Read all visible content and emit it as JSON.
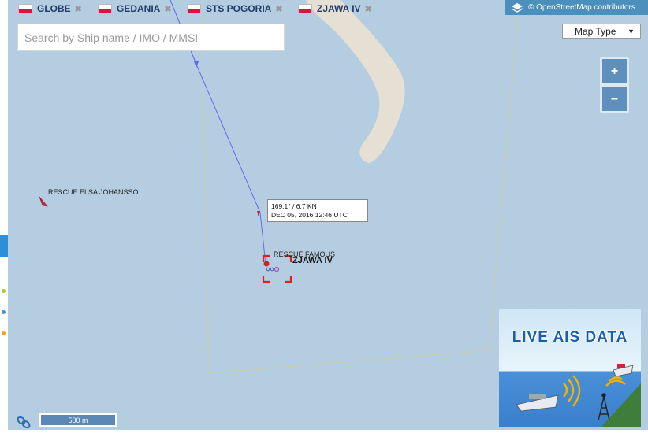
{
  "tabs": [
    {
      "label": "GLOBE",
      "close": "✖"
    },
    {
      "label": "GEDANIA",
      "close": "✖"
    },
    {
      "label": "STS POGORIA",
      "close": "✖"
    },
    {
      "label": "ZJAWA IV",
      "close": "✖"
    }
  ],
  "attribution": "© OpenStreetMap contributors",
  "search": {
    "placeholder": "Search by Ship name / IMO / MMSI",
    "value": ""
  },
  "map_type": {
    "label": "Map Type",
    "caret": "▼"
  },
  "zoom": {
    "in": "+",
    "out": "–"
  },
  "vessels": [
    {
      "name": "RESCUE ELSA JOHANSSO"
    },
    {
      "name": "RESCUE FAMOUS"
    },
    {
      "name": "ZJAWA IV",
      "selected": true
    }
  ],
  "position_tooltip": {
    "course_speed": "169.1° / 6.7 KN",
    "timestamp": "DEC 05, 2016 12:46 UTC"
  },
  "advert": {
    "title": "LIVE AIS DATA"
  },
  "scale_bar": "500 m",
  "colors": {
    "sea": "#b5cde1",
    "land": "#e5e0d3",
    "track": "#5b6cf0",
    "selection": "#e0201c",
    "vessel_marker": "#c8283c",
    "tab_text": "#1f3c6a"
  },
  "icons": {
    "tab_flag": "poland-flag-icon",
    "tab_close": "close-icon",
    "layers": "layers-icon",
    "link": "link-icon"
  }
}
